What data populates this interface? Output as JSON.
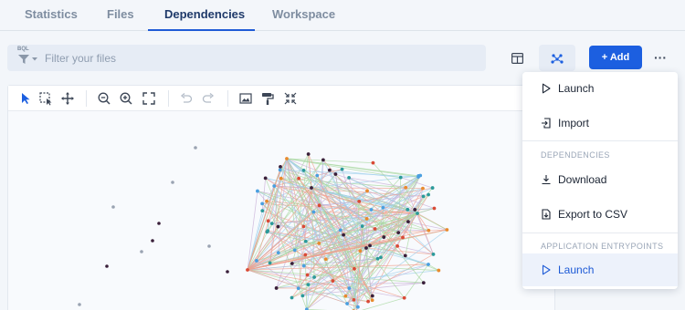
{
  "tabs": [
    {
      "label": "Statistics",
      "active": false
    },
    {
      "label": "Files",
      "active": false
    },
    {
      "label": "Dependencies",
      "active": true
    },
    {
      "label": "Workspace",
      "active": false
    }
  ],
  "filter": {
    "badge": "BQL",
    "placeholder": "Filter your files"
  },
  "actions": {
    "add_label": "+ Add",
    "more_label": "···"
  },
  "toolbar_icons": [
    "cursor-icon",
    "box-select-icon",
    "move-icon",
    "zoom-out-icon",
    "zoom-in-icon",
    "fit-screen-icon",
    "undo-icon",
    "redo-icon",
    "image-export-icon",
    "paint-roller-icon",
    "collapse-icon"
  ],
  "menu": {
    "items_top": [
      {
        "label": "Launch",
        "icon": "play-icon"
      },
      {
        "label": "Import",
        "icon": "import-icon"
      }
    ],
    "sections": [
      {
        "title": "DEPENDENCIES",
        "items": [
          {
            "label": "Download",
            "icon": "download-icon"
          },
          {
            "label": "Export to CSV",
            "icon": "export-icon"
          }
        ]
      },
      {
        "title": "APPLICATION ENTRYPOINTS",
        "items": [
          {
            "label": "Launch",
            "icon": "play-icon",
            "active": true
          }
        ]
      }
    ]
  },
  "colors": {
    "accent": "#1c5fe0",
    "node_dark": "#3a1f3a",
    "node_orange": "#e88a2e",
    "node_red": "#d94a36",
    "node_teal": "#2b9a9a",
    "node_blue": "#4a9fe0",
    "edge_red": "#f0a08c",
    "edge_blue": "#9fd0ec",
    "edge_green": "#a8d8a0"
  }
}
